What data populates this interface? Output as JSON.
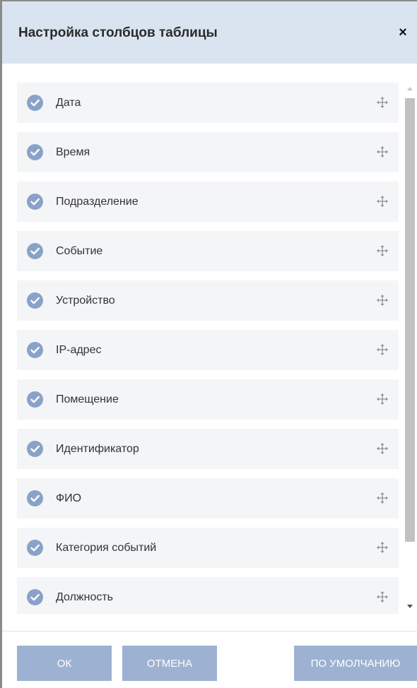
{
  "dialog": {
    "title": "Настройка столбцов таблицы",
    "close_label": "×"
  },
  "columns": [
    {
      "label": "Дата",
      "checked": true
    },
    {
      "label": "Время",
      "checked": true
    },
    {
      "label": "Подразделение",
      "checked": true
    },
    {
      "label": "Событие",
      "checked": true
    },
    {
      "label": "Устройство",
      "checked": true
    },
    {
      "label": "IP-адрес",
      "checked": true
    },
    {
      "label": "Помещение",
      "checked": true
    },
    {
      "label": "Идентификатор",
      "checked": true
    },
    {
      "label": "ФИО",
      "checked": true
    },
    {
      "label": "Категория событий",
      "checked": true
    },
    {
      "label": "Должность",
      "checked": true
    }
  ],
  "buttons": {
    "ok": "ОК",
    "cancel": "ОТМЕНА",
    "default": "ПО УМОЛЧАНИЮ"
  },
  "icons": {
    "check": "check-circle-icon",
    "drag": "move-arrows-icon",
    "close": "close-icon"
  },
  "colors": {
    "header_bg": "#d9e4f0",
    "item_bg": "#f4f5f7",
    "check_bg": "#8aa2c8",
    "button_bg": "#9db2d2"
  }
}
